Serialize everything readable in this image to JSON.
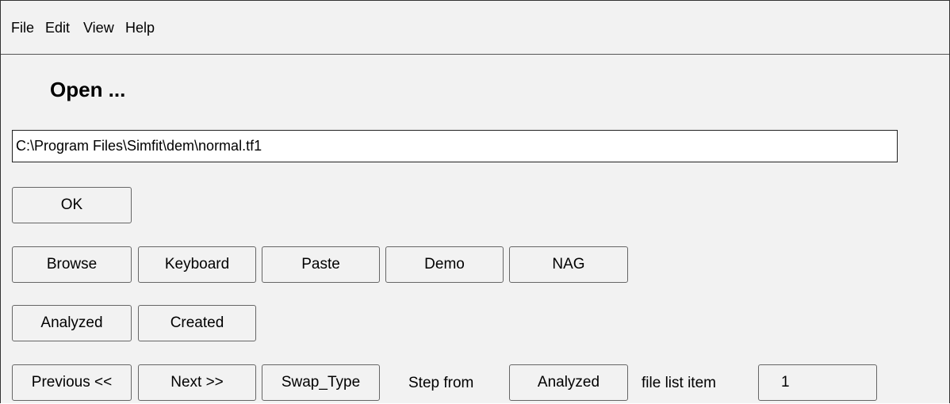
{
  "menu": {
    "file": "File",
    "edit": "Edit",
    "view": "View",
    "help": "Help"
  },
  "dialog": {
    "title": "Open ...",
    "path_value": "C:\\Program Files\\Simfit\\dem\\normal.tf1"
  },
  "buttons": {
    "ok": "OK",
    "browse": "Browse",
    "keyboard": "Keyboard",
    "paste": "Paste",
    "demo": "Demo",
    "nag": "NAG",
    "analyzed": "Analyzed",
    "created": "Created",
    "previous": "Previous <<",
    "next": "Next >>",
    "swap_type": "Swap_Type",
    "step_source": "Analyzed"
  },
  "labels": {
    "step_from": "Step from",
    "file_list_item": "file list item"
  },
  "file_list_item_value": "1"
}
